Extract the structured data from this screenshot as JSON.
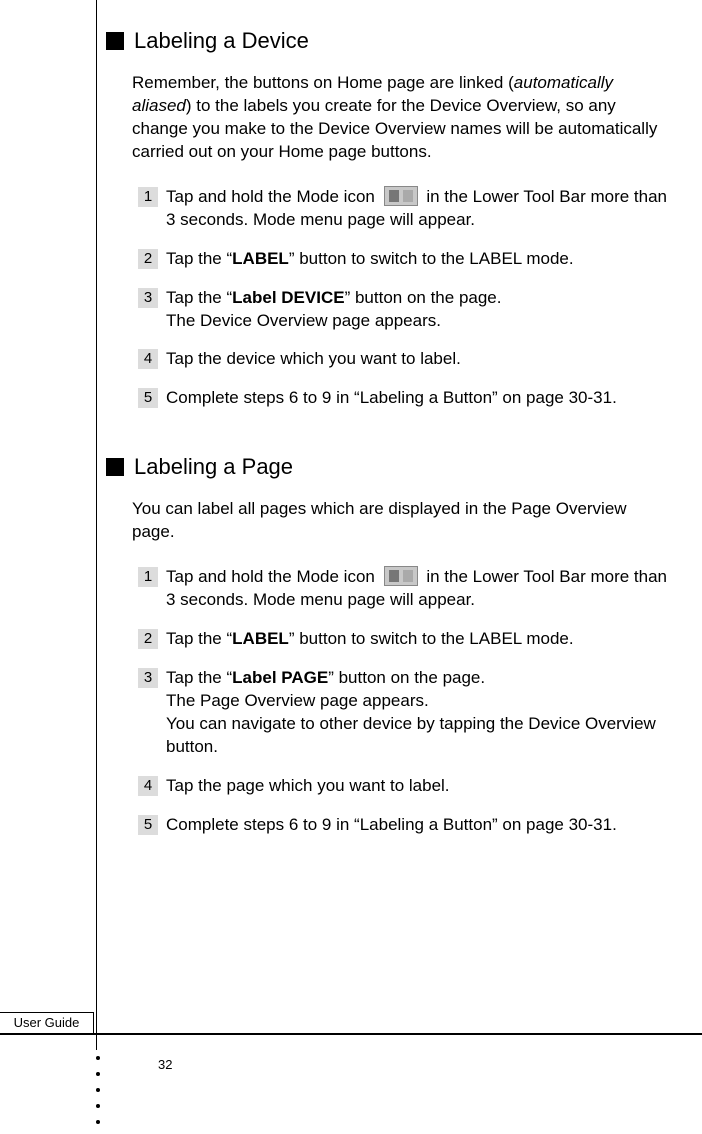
{
  "section1": {
    "heading": "Labeling a Device",
    "intro_pre": "Remember, the buttons on Home page are linked (",
    "intro_ital": "automatically aliased",
    "intro_post": ") to the labels you create for the Device Overview, so any change you make to the Device Overview names will be automatically carried out on your Home page buttons.",
    "steps": [
      {
        "num": "1",
        "pre": "Tap and hold the Mode icon ",
        "post": " in the Lower Tool Bar more than 3 seconds. Mode menu page will appear.",
        "has_icon": true
      },
      {
        "num": "2",
        "pre": "Tap the “",
        "bold": "LABEL",
        "post": "” button to switch to the LABEL mode."
      },
      {
        "num": "3",
        "pre": "Tap the “",
        "bold": "Label DEVICE",
        "post": "” button on the page.",
        "line2": "The Device Overview page appears."
      },
      {
        "num": "4",
        "text": "Tap the device which you want to label."
      },
      {
        "num": "5",
        "text": "Complete steps 6 to 9 in “Labeling a Button” on page 30-31."
      }
    ]
  },
  "section2": {
    "heading": "Labeling a Page",
    "intro": "You can label all pages which are displayed in the Page Overview page.",
    "steps": [
      {
        "num": "1",
        "pre": "Tap and hold the Mode icon ",
        "post": " in the Lower Tool Bar more than 3 seconds. Mode menu page will appear.",
        "has_icon": true
      },
      {
        "num": "2",
        "pre": "Tap the “",
        "bold": "LABEL",
        "post": "” button to switch to the LABEL mode."
      },
      {
        "num": "3",
        "pre": "Tap the “",
        "bold": "Label PAGE",
        "post": "” button on the page.",
        "line2": "The Page Overview page appears.",
        "line3": "You can navigate to other device by tapping the Device Overview button."
      },
      {
        "num": "4",
        "text": "Tap the page which you want to label."
      },
      {
        "num": "5",
        "text": "Complete steps 6 to 9 in “Labeling a Button” on page 30-31."
      }
    ]
  },
  "footer": {
    "user_guide": "User Guide",
    "page_number": "32"
  }
}
